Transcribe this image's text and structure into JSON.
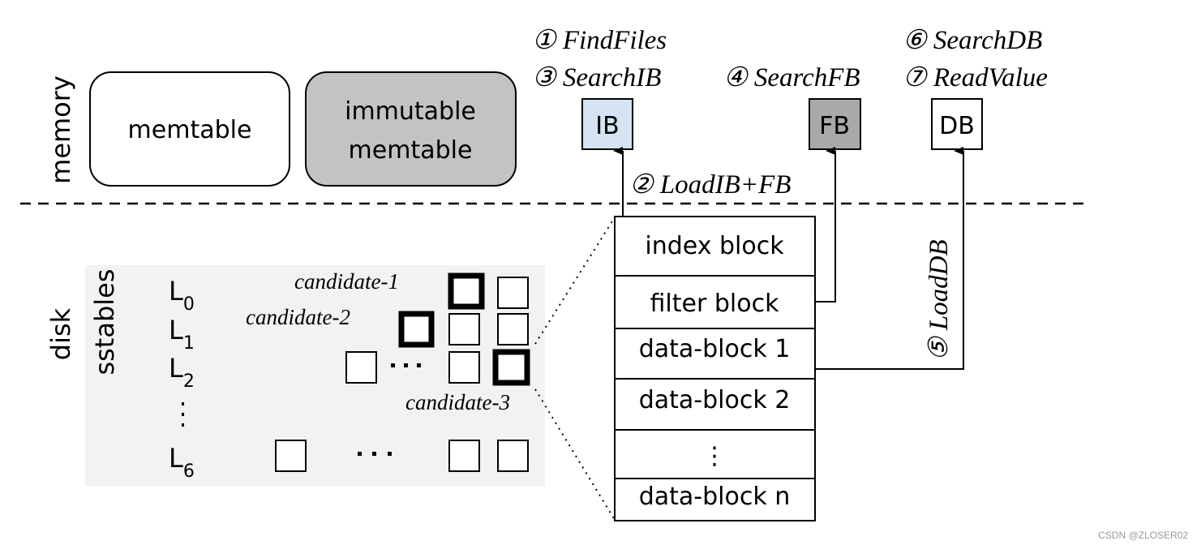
{
  "regions": {
    "memory": "memory",
    "disk": "disk",
    "sstables": "sstables"
  },
  "memory_tables": {
    "memtable": "memtable",
    "immutable_line1": "immutable",
    "immutable_line2": "memtable"
  },
  "cached_blocks": {
    "ib": "IB",
    "fb": "FB",
    "db": "DB"
  },
  "steps": {
    "s1": "① FindFiles",
    "s2": "② LoadIB+FB",
    "s3": "③ SearchIB",
    "s4": "④ SearchFB",
    "s5": "⑤ LoadDB",
    "s6": "⑥ SearchDB",
    "s7": "⑦ ReadValue"
  },
  "levels": {
    "l0": {
      "base": "L",
      "sub": "0"
    },
    "l1": {
      "base": "L",
      "sub": "1"
    },
    "l2": {
      "base": "L",
      "sub": "2"
    },
    "l6": {
      "base": "L",
      "sub": "6"
    }
  },
  "candidates": [
    "candidate-1",
    "candidate-2",
    "candidate-3"
  ],
  "sstable_blocks": [
    "index block",
    "filter block",
    "data-block 1",
    "data-block 2",
    "⋮",
    "data-block n"
  ],
  "colors": {
    "ib_fill": "#d5e3f2",
    "fb_fill": "#a9a9a9",
    "immutable_fill": "#c3c3c3",
    "disk_bg": "#f2f2f2"
  },
  "watermark": "CSDN @ZLOSER02"
}
